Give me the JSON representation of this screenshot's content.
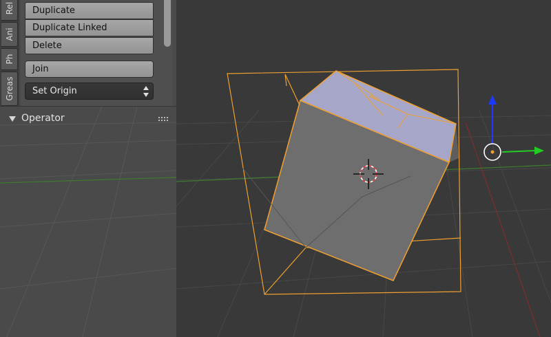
{
  "toolshelf": {
    "tabs": [
      {
        "label": "Rel",
        "active": false
      },
      {
        "label": "Ani",
        "active": false
      },
      {
        "label": "Ph",
        "active": false
      },
      {
        "label": "Greas",
        "active": false
      }
    ],
    "buttons": {
      "duplicate": "Duplicate",
      "duplicate_linked": "Duplicate Linked",
      "delete": "Delete",
      "join": "Join",
      "set_origin": "Set Origin"
    },
    "operator_panel": {
      "label": "Operator",
      "expanded": true
    }
  },
  "viewport": {
    "colors": {
      "background": "#393939",
      "grid": "#4a4a4a",
      "x_axis": "#7a2d2d",
      "y_axis": "#3f7a2e",
      "selection": "#f0a030",
      "selected_face": "#a6a6c8",
      "object_face": "#6e6e6e",
      "manipulator_z": "#1a3aff",
      "manipulator_y": "#22cc22"
    },
    "icons": [
      "3d-cursor-icon",
      "transform-manipulator-icon"
    ]
  }
}
